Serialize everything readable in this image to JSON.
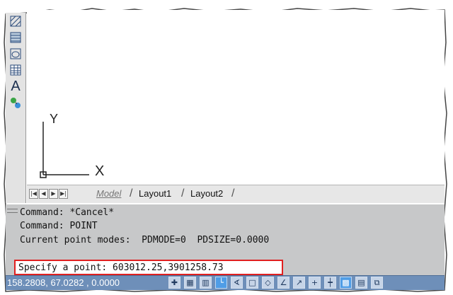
{
  "toolbar": {
    "items": [
      {
        "icon": "hatch-icon"
      },
      {
        "icon": "gradient-icon"
      },
      {
        "icon": "region-icon"
      },
      {
        "icon": "table-icon"
      },
      {
        "icon": "multiline-text-icon",
        "glyph": "A"
      },
      {
        "icon": "add-selected-icon"
      }
    ]
  },
  "drawing": {
    "ucs": {
      "y_label": "Y",
      "x_label": "X"
    }
  },
  "layout_tabs": {
    "nav_arrows": [
      "|◀",
      "◀",
      "▶",
      "▶|"
    ],
    "tabs": [
      {
        "label": "Model",
        "active": true
      },
      {
        "label": "Layout1",
        "active": false
      },
      {
        "label": "Layout2",
        "active": false
      }
    ]
  },
  "command_window": {
    "history": [
      "Command: *Cancel*",
      "Command: POINT",
      "Current point modes:  PDMODE=0  PDSIZE=0.0000"
    ],
    "prompt": "Specify a point: 603012.25,3901258.73"
  },
  "status_bar": {
    "coordinates": "158.2808, 67.0282 , 0.0000",
    "toggles": [
      {
        "icon": "infer-constraints-icon",
        "on": false
      },
      {
        "icon": "snap-mode-icon",
        "on": false
      },
      {
        "icon": "grid-display-icon",
        "on": false
      },
      {
        "icon": "ortho-mode-icon",
        "on": true
      },
      {
        "icon": "polar-tracking-icon",
        "on": false
      },
      {
        "icon": "object-snap-icon",
        "on": false
      },
      {
        "icon": "3d-object-snap-icon",
        "on": false
      },
      {
        "icon": "object-snap-tracking-icon",
        "on": false
      },
      {
        "icon": "dynamic-ucs-icon",
        "on": false
      },
      {
        "icon": "dynamic-input-icon",
        "on": false
      },
      {
        "icon": "lineweight-icon",
        "on": false
      },
      {
        "icon": "transparency-icon",
        "on": true
      },
      {
        "icon": "quick-properties-icon",
        "on": false
      },
      {
        "icon": "selection-cycling-icon",
        "on": false
      }
    ]
  },
  "colors": {
    "status_bar": "#6e8fb9",
    "command_bg": "#c7c8c9",
    "highlight": "#e02020"
  }
}
